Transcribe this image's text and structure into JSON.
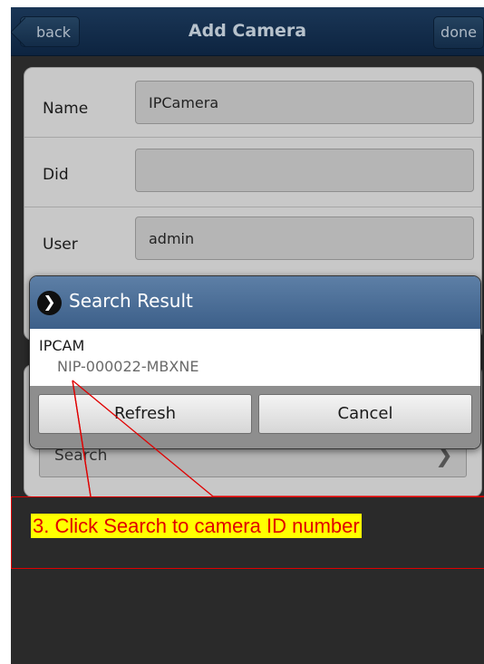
{
  "header": {
    "back_label": "back",
    "title": "Add Camera",
    "done_label": "done"
  },
  "form": {
    "name_label": "Name",
    "name_value": "IPCamera",
    "did_label": "Did",
    "did_value": "",
    "user_label": "User",
    "user_value": "admin"
  },
  "panel2": {
    "search_label": "Search"
  },
  "dialog": {
    "title": "Search Result",
    "result_name": "IPCAM",
    "result_id": "NIP-000022-MBXNE",
    "refresh_label": "Refresh",
    "cancel_label": "Cancel"
  },
  "annotation": {
    "text": "3. Click Search to camera ID number"
  },
  "colors": {
    "header_bg": "#0d2440",
    "dialog_header": "#4a6d96",
    "annotation": "#e00000",
    "highlight": "#ffff00"
  }
}
